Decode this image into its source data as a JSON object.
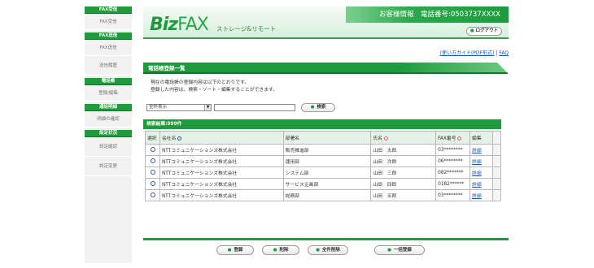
{
  "sidebar": {
    "sections": [
      {
        "heading": "FAX受信",
        "items": [
          "FAX受信"
        ]
      },
      {
        "heading": "FAX送信",
        "items": [
          "FAX送信",
          "送信履歴"
        ]
      },
      {
        "heading": "電話帳",
        "items": [
          "登録/編集"
        ]
      },
      {
        "heading": "通話明細",
        "items": [
          "明細の確認"
        ]
      },
      {
        "heading": "設定状況",
        "items": [
          "設定確認",
          "設定変更"
        ]
      }
    ]
  },
  "header": {
    "logo_biz": "Biz",
    "logo_fax": "FAX",
    "tagline": "ストレージ&リモート",
    "customer_info": "お客様情報　電話番号:0503737XXXX",
    "logout_label": "ログアウト"
  },
  "help": {
    "guide_link": "(使い方ガイド(PDF形式)",
    "separator": "|",
    "faq_link": "FAQ"
  },
  "page": {
    "title": "電話帳登録一覧",
    "description_1": "現在の電話帳の登録内容は以下のとおりです。",
    "description_2": "登録した内容は、検索・ソート・編集することができます。"
  },
  "search": {
    "filter_value": "全件表示",
    "button_label": "検索"
  },
  "results": {
    "summary": "検索結果:999件",
    "columns": {
      "select": "選択",
      "company": "会社名",
      "department": "部署名",
      "name": "氏名",
      "fax": "FAX番号",
      "edit": "編集"
    },
    "rows": [
      {
        "company": "NTTコミュニケーションズ株式会社",
        "department": "販売推進部",
        "name": "山田　太郎",
        "fax": "03********",
        "detail": "詳細"
      },
      {
        "company": "NTTコミュニケーションズ株式会社",
        "department": "運用部",
        "name": "山田　次郎",
        "fax": "06********",
        "detail": "詳細"
      },
      {
        "company": "NTTコミュニケーションズ株式会社",
        "department": "システム部",
        "name": "山田　三郎",
        "fax": "082*******",
        "detail": "詳細"
      },
      {
        "company": "NTTコミュニケーションズ株式会社",
        "department": "サービス企画部",
        "name": "山田　四郎",
        "fax": "0182******",
        "detail": "詳細"
      },
      {
        "company": "NTTコミュニケーションズ株式会社",
        "department": "総務部",
        "name": "山田　五郎",
        "fax": "03********",
        "detail": "詳細"
      }
    ]
  },
  "actions": {
    "register": "登録",
    "delete": "削除",
    "delete_all": "全件削除",
    "bulk_register": "一括登録"
  },
  "colors": {
    "brand_green": "#1f9a3c",
    "link_blue": "#1a55b0"
  }
}
